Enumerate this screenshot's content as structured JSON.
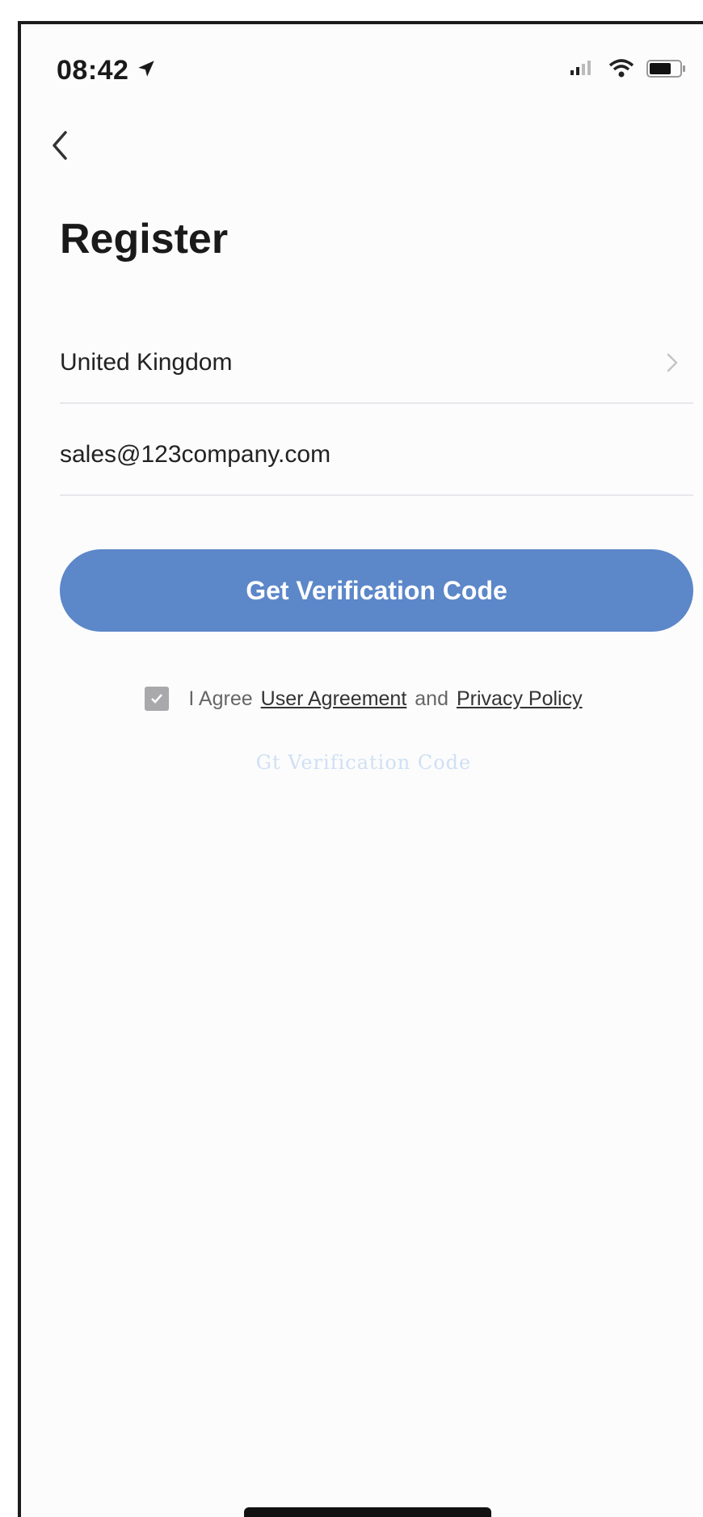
{
  "status_bar": {
    "time": "08:42",
    "icons": [
      "location-arrow-icon",
      "signal-icon",
      "wifi-icon",
      "battery-icon"
    ]
  },
  "nav": {
    "back_icon": "chevron-left-icon"
  },
  "page": {
    "title": "Register"
  },
  "form": {
    "country": {
      "value": "United Kingdom",
      "icon": "chevron-right-icon"
    },
    "email": {
      "value": "sales@123company.com"
    },
    "submit_label": "Get Verification Code"
  },
  "agreement": {
    "checked": true,
    "prefix": "I Agree",
    "user_agreement": "User Agreement",
    "conjunction": "and",
    "privacy_policy": "Privacy Policy"
  },
  "hint_text": "Gt Verification Code",
  "colors": {
    "primary": "#5c87c9",
    "checkbox": "#a9a9ab",
    "hint": "#cfe0f4"
  }
}
